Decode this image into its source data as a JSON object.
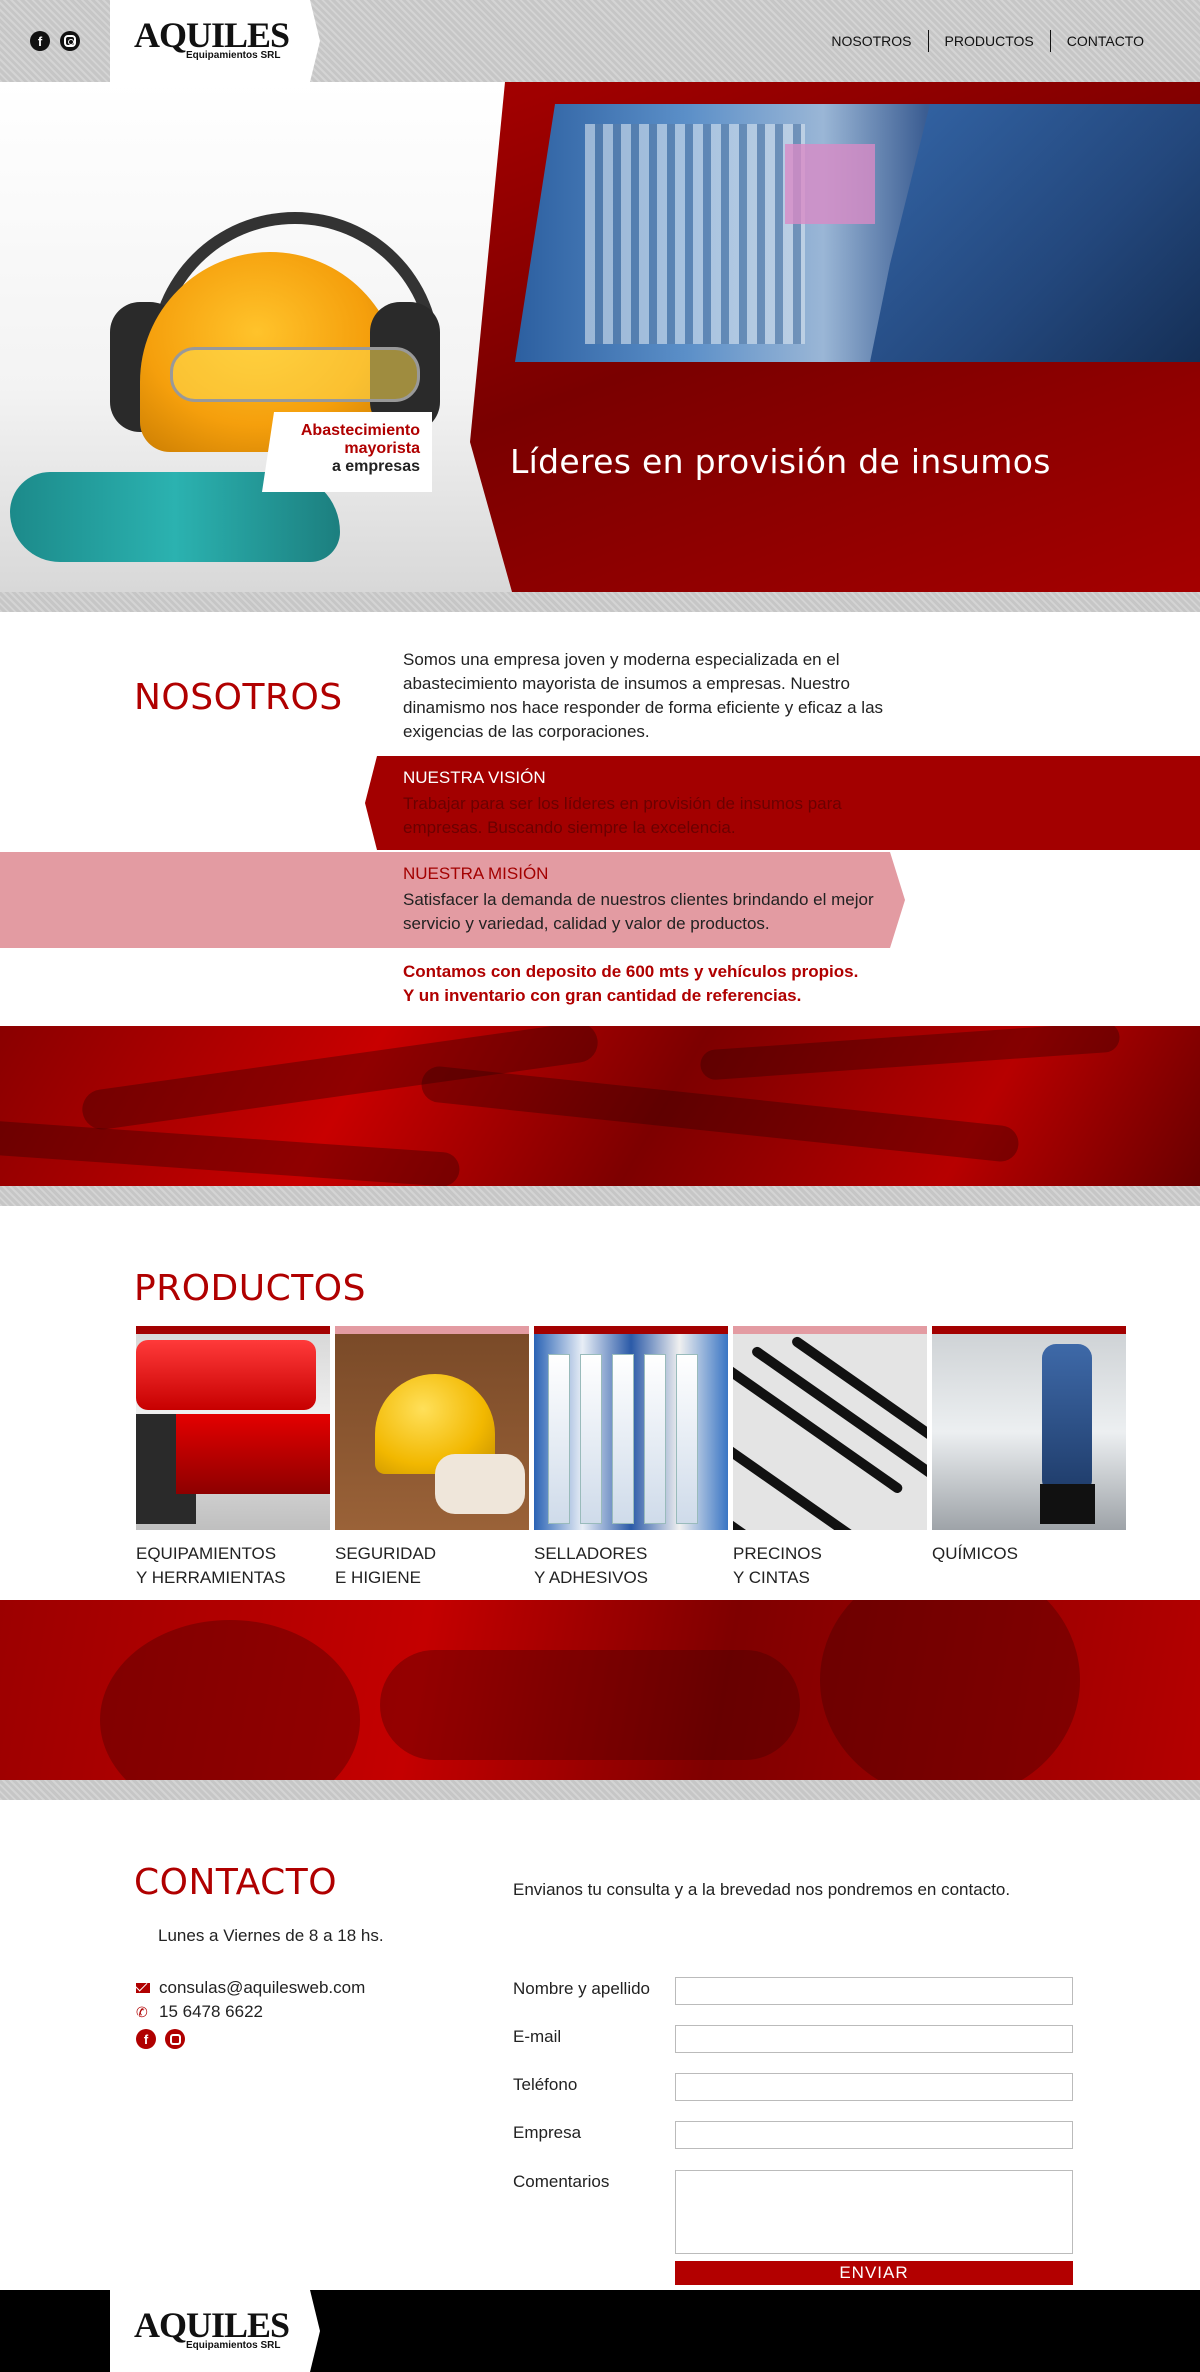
{
  "header": {
    "social": [
      {
        "icon": "facebook-icon",
        "glyph": "f"
      },
      {
        "icon": "instagram-icon"
      }
    ],
    "logo": {
      "name": "AQUILES",
      "subtitle": "Equipamientos SRL"
    },
    "nav": [
      {
        "label": "NOSOTROS"
      },
      {
        "label": "PRODUCTOS"
      },
      {
        "label": "CONTACTO"
      }
    ]
  },
  "hero": {
    "badge_line1": "Abastecimiento",
    "badge_line2": "mayorista",
    "badge_line3": "a empresas",
    "title": "Líderes en provisión de insumos"
  },
  "nosotros": {
    "title": "NOSOTROS",
    "intro": "Somos una empresa joven y moderna especializada en el abastecimiento mayorista de insumos a empresas. Nuestro dinamismo nos hace responder de forma eficiente y eficaz a las exigencias de las corporaciones.",
    "vision_label": "NUESTRA VISIÓN",
    "vision_text": "Trabajar para ser los líderes en provisión de insumos para empresas. Buscando siempre la excelencia.",
    "mision_label": "NUESTRA MISIÓN",
    "mision_text": "Satisfacer la demanda de nuestros clientes brindando el mejor servicio y variedad, calidad y valor de productos.",
    "highlight_line1": "Contamos con deposito de 600 mts y vehículos propios.",
    "highlight_line2": "Y un inventario con gran cantidad de referencias."
  },
  "productos": {
    "title": "PRODUCTOS",
    "items": [
      {
        "line1": "EQUIPAMIENTOS",
        "line2": "Y HERRAMIENTAS",
        "bar_color": "#a30000"
      },
      {
        "line1": "SEGURIDAD",
        "line2": "E HIGIENE",
        "bar_color": "#e39ba2"
      },
      {
        "line1": "SELLADORES",
        "line2": "Y ADHESIVOS",
        "bar_color": "#a30000"
      },
      {
        "line1": "PRECINOS",
        "line2": "Y CINTAS",
        "bar_color": "#e39ba2"
      },
      {
        "line1": "QUÍMICOS",
        "line2": "",
        "bar_color": "#a30000"
      }
    ]
  },
  "contacto": {
    "title": "CONTACTO",
    "hours": "Lunes a Viernes de 8 a 18 hs.",
    "email": "consulas@aquilesweb.com",
    "phone": "15 6478 6622",
    "intro": "Envianos tu consulta y a la brevedad nos pondremos en contacto.",
    "fields": {
      "name_label": "Nombre y apellido",
      "email_label": "E-mail",
      "phone_label": "Teléfono",
      "company_label": "Empresa",
      "comments_label": "Comentarios"
    },
    "send_label": "ENVIAR"
  },
  "footer": {
    "logo": {
      "name": "AQUILES",
      "subtitle": "Equipamientos SRL"
    }
  },
  "colors": {
    "brand_red": "#b00000",
    "dark_red": "#a30000",
    "pink": "#e39ba2",
    "band_gray": "#c6c6c6"
  }
}
